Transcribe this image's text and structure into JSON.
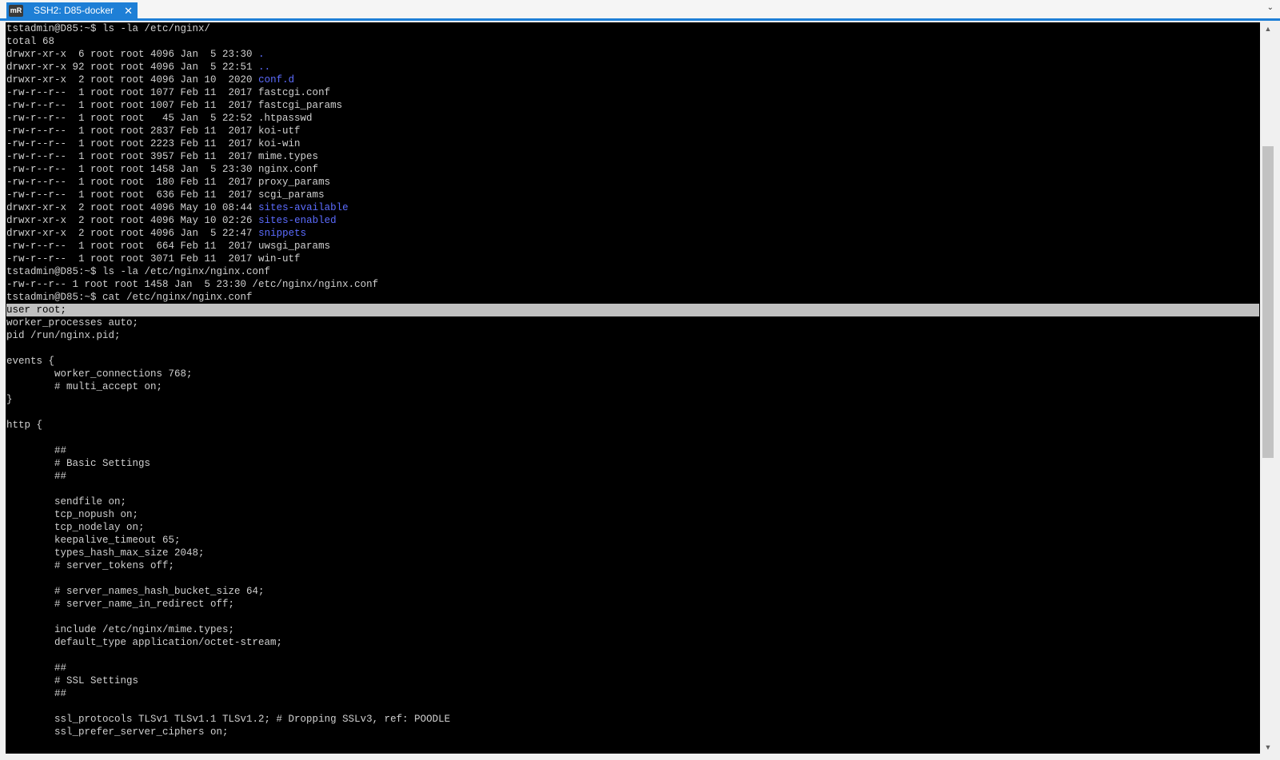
{
  "tab": {
    "icon_text": "mR",
    "title": "SSH2: D85-docker",
    "close_glyph": "✕"
  },
  "tabbar": {
    "dropdown_glyph": "⌄"
  },
  "scrollbar": {
    "up_glyph": "▲",
    "down_glyph": "▼"
  },
  "colors": {
    "tab_active": "#1e7fd6",
    "terminal_bg": "#000000",
    "terminal_fg": "#d0d0d0",
    "directory": "#5c6cff",
    "selection": "#c0c0c0"
  },
  "terminal": {
    "lines": [
      {
        "segs": [
          {
            "t": "tstadmin@D85:~$ ls -la /etc/nginx/"
          }
        ]
      },
      {
        "segs": [
          {
            "t": "total 68"
          }
        ]
      },
      {
        "segs": [
          {
            "t": "drwxr-xr-x  6 root root 4096 Jan  5 23:30 "
          },
          {
            "t": ".",
            "c": "dir"
          }
        ]
      },
      {
        "segs": [
          {
            "t": "drwxr-xr-x 92 root root 4096 Jan  5 22:51 "
          },
          {
            "t": "..",
            "c": "dir"
          }
        ]
      },
      {
        "segs": [
          {
            "t": "drwxr-xr-x  2 root root 4096 Jan 10  2020 "
          },
          {
            "t": "conf.d",
            "c": "dir"
          }
        ]
      },
      {
        "segs": [
          {
            "t": "-rw-r--r--  1 root root 1077 Feb 11  2017 fastcgi.conf"
          }
        ]
      },
      {
        "segs": [
          {
            "t": "-rw-r--r--  1 root root 1007 Feb 11  2017 fastcgi_params"
          }
        ]
      },
      {
        "segs": [
          {
            "t": "-rw-r--r--  1 root root   45 Jan  5 22:52 .htpasswd"
          }
        ]
      },
      {
        "segs": [
          {
            "t": "-rw-r--r--  1 root root 2837 Feb 11  2017 koi-utf"
          }
        ]
      },
      {
        "segs": [
          {
            "t": "-rw-r--r--  1 root root 2223 Feb 11  2017 koi-win"
          }
        ]
      },
      {
        "segs": [
          {
            "t": "-rw-r--r--  1 root root 3957 Feb 11  2017 mime.types"
          }
        ]
      },
      {
        "segs": [
          {
            "t": "-rw-r--r--  1 root root 1458 Jan  5 23:30 nginx.conf"
          }
        ]
      },
      {
        "segs": [
          {
            "t": "-rw-r--r--  1 root root  180 Feb 11  2017 proxy_params"
          }
        ]
      },
      {
        "segs": [
          {
            "t": "-rw-r--r--  1 root root  636 Feb 11  2017 scgi_params"
          }
        ]
      },
      {
        "segs": [
          {
            "t": "drwxr-xr-x  2 root root 4096 May 10 08:44 "
          },
          {
            "t": "sites-available",
            "c": "dir"
          }
        ]
      },
      {
        "segs": [
          {
            "t": "drwxr-xr-x  2 root root 4096 May 10 02:26 "
          },
          {
            "t": "sites-enabled",
            "c": "dir"
          }
        ]
      },
      {
        "segs": [
          {
            "t": "drwxr-xr-x  2 root root 4096 Jan  5 22:47 "
          },
          {
            "t": "snippets",
            "c": "dir"
          }
        ]
      },
      {
        "segs": [
          {
            "t": "-rw-r--r--  1 root root  664 Feb 11  2017 uwsgi_params"
          }
        ]
      },
      {
        "segs": [
          {
            "t": "-rw-r--r--  1 root root 3071 Feb 11  2017 win-utf"
          }
        ]
      },
      {
        "segs": [
          {
            "t": "tstadmin@D85:~$ ls -la /etc/nginx/nginx.conf"
          }
        ]
      },
      {
        "segs": [
          {
            "t": "-rw-r--r-- 1 root root 1458 Jan  5 23:30 /etc/nginx/nginx.conf"
          }
        ]
      },
      {
        "segs": [
          {
            "t": "tstadmin@D85:~$ cat /etc/nginx/nginx.conf"
          }
        ]
      },
      {
        "hl": true,
        "segs": [
          {
            "t": "user root;"
          }
        ]
      },
      {
        "segs": [
          {
            "t": "worker_processes auto;"
          }
        ]
      },
      {
        "segs": [
          {
            "t": "pid /run/nginx.pid;"
          }
        ]
      },
      {
        "segs": [
          {
            "t": ""
          }
        ]
      },
      {
        "segs": [
          {
            "t": "events {"
          }
        ]
      },
      {
        "segs": [
          {
            "t": "        worker_connections 768;"
          }
        ]
      },
      {
        "segs": [
          {
            "t": "        # multi_accept on;"
          }
        ]
      },
      {
        "segs": [
          {
            "t": "}"
          }
        ]
      },
      {
        "segs": [
          {
            "t": ""
          }
        ]
      },
      {
        "segs": [
          {
            "t": "http {"
          }
        ]
      },
      {
        "segs": [
          {
            "t": ""
          }
        ]
      },
      {
        "segs": [
          {
            "t": "        ##"
          }
        ]
      },
      {
        "segs": [
          {
            "t": "        # Basic Settings"
          }
        ]
      },
      {
        "segs": [
          {
            "t": "        ##"
          }
        ]
      },
      {
        "segs": [
          {
            "t": ""
          }
        ]
      },
      {
        "segs": [
          {
            "t": "        sendfile on;"
          }
        ]
      },
      {
        "segs": [
          {
            "t": "        tcp_nopush on;"
          }
        ]
      },
      {
        "segs": [
          {
            "t": "        tcp_nodelay on;"
          }
        ]
      },
      {
        "segs": [
          {
            "t": "        keepalive_timeout 65;"
          }
        ]
      },
      {
        "segs": [
          {
            "t": "        types_hash_max_size 2048;"
          }
        ]
      },
      {
        "segs": [
          {
            "t": "        # server_tokens off;"
          }
        ]
      },
      {
        "segs": [
          {
            "t": ""
          }
        ]
      },
      {
        "segs": [
          {
            "t": "        # server_names_hash_bucket_size 64;"
          }
        ]
      },
      {
        "segs": [
          {
            "t": "        # server_name_in_redirect off;"
          }
        ]
      },
      {
        "segs": [
          {
            "t": ""
          }
        ]
      },
      {
        "segs": [
          {
            "t": "        include /etc/nginx/mime.types;"
          }
        ]
      },
      {
        "segs": [
          {
            "t": "        default_type application/octet-stream;"
          }
        ]
      },
      {
        "segs": [
          {
            "t": ""
          }
        ]
      },
      {
        "segs": [
          {
            "t": "        ##"
          }
        ]
      },
      {
        "segs": [
          {
            "t": "        # SSL Settings"
          }
        ]
      },
      {
        "segs": [
          {
            "t": "        ##"
          }
        ]
      },
      {
        "segs": [
          {
            "t": ""
          }
        ]
      },
      {
        "segs": [
          {
            "t": "        ssl_protocols TLSv1 TLSv1.1 TLSv1.2; # Dropping SSLv3, ref: POODLE"
          }
        ]
      },
      {
        "segs": [
          {
            "t": "        ssl_prefer_server_ciphers on;"
          }
        ]
      }
    ]
  }
}
